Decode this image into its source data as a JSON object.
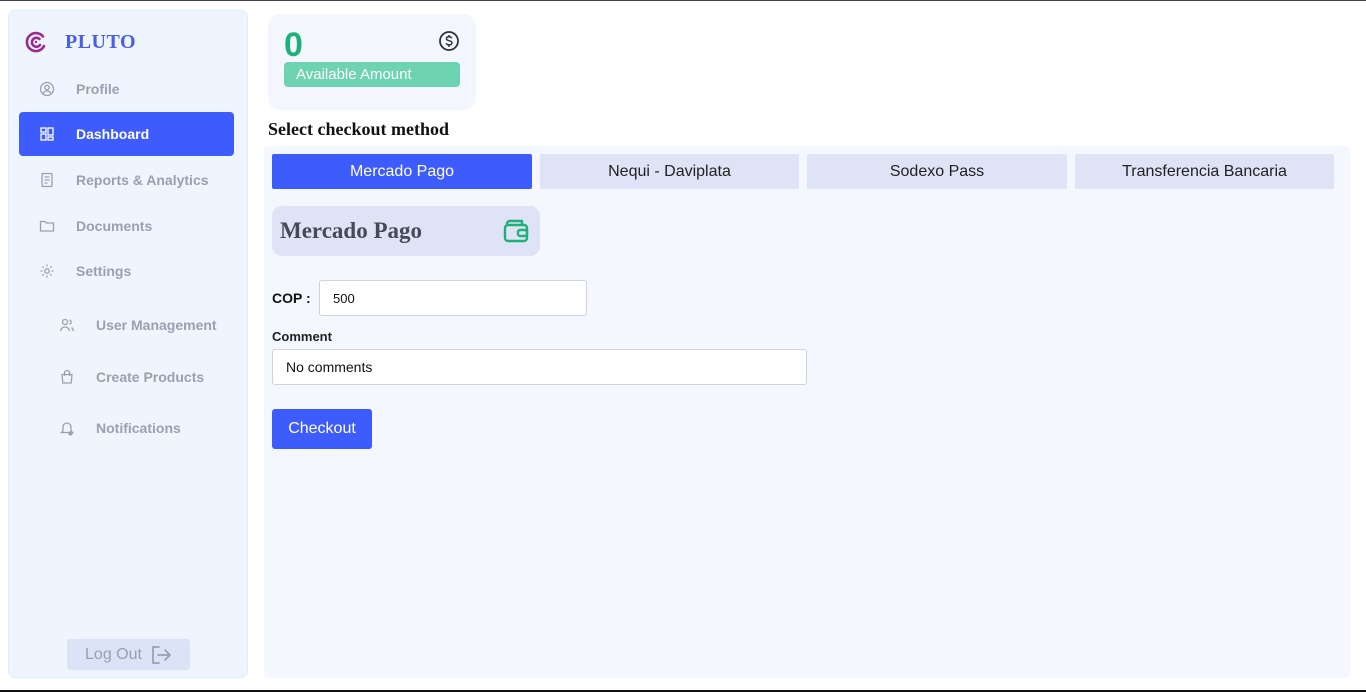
{
  "brand": {
    "name": "PLUTO",
    "logo_icon": "pluto-logo-icon",
    "logo_color": "#9b2a8a"
  },
  "sidebar": {
    "items": [
      {
        "label": "Profile",
        "icon": "user-circle-icon"
      },
      {
        "label": "Dashboard",
        "icon": "dashboard-grid-icon",
        "active": true
      },
      {
        "label": "Reports & Analytics",
        "icon": "document-icon"
      },
      {
        "label": "Documents",
        "icon": "folder-icon"
      },
      {
        "label": "Settings",
        "icon": "gear-icon"
      }
    ],
    "sub_items": [
      {
        "label": "User Management",
        "icon": "users-icon"
      },
      {
        "label": "Create Products",
        "icon": "shopping-bag-icon"
      },
      {
        "label": "Notifications",
        "icon": "bell-icon"
      }
    ],
    "logout_label": "Log Out"
  },
  "amount_card": {
    "value": "0",
    "label": "Available Amount",
    "icon": "dollar-circle-icon"
  },
  "checkout": {
    "title": "Select checkout method",
    "tabs": [
      "Mercado Pago",
      "Nequi - Daviplata",
      "Sodexo Pass",
      "Transferencia Bancaria"
    ],
    "active_tab": 0,
    "method_title": "Mercado Pago",
    "method_icon": "wallet-icon",
    "cop_label": "COP :",
    "cop_value": "500",
    "comment_label": "Comment",
    "comment_value": "No comments",
    "button_label": "Checkout"
  },
  "colors": {
    "accent": "#3e5bfb",
    "green": "#1fb07a",
    "label_green": "#6dd3b1",
    "sidebar_bg": "#eef5ff"
  }
}
